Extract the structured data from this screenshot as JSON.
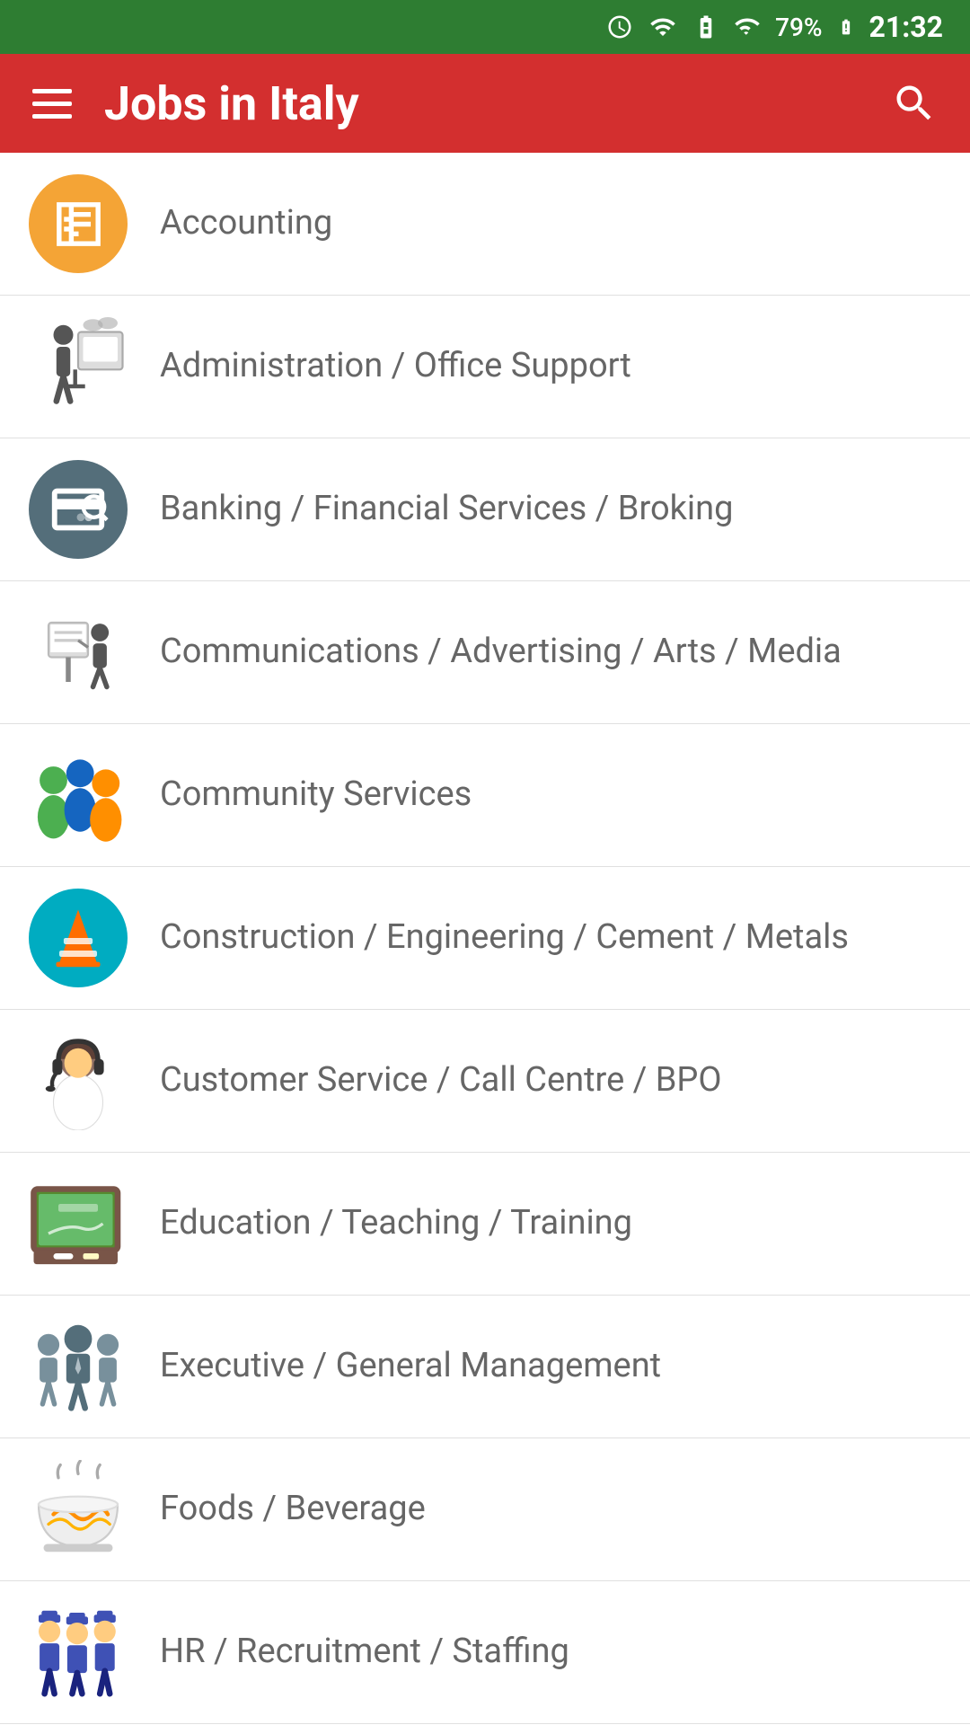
{
  "statusBar": {
    "battery": "79%",
    "time": "21:32",
    "icons": [
      "alarm",
      "wifi",
      "battery-charge",
      "signal",
      "signal2"
    ]
  },
  "toolbar": {
    "title": "Jobs in Italy",
    "menuLabel": "Menu",
    "searchLabel": "Search"
  },
  "categories": [
    {
      "id": "accounting",
      "label": "Accounting",
      "iconType": "circle-orange",
      "emoji": "🧮"
    },
    {
      "id": "admin",
      "label": "Administration / Office Support",
      "iconType": "illustration",
      "emoji": "📋"
    },
    {
      "id": "banking",
      "label": "Banking / Financial Services / Broking",
      "iconType": "circle-teal",
      "emoji": "💳"
    },
    {
      "id": "communications",
      "label": "Communications / Advertising / Arts / Media",
      "iconType": "illustration",
      "emoji": "📣"
    },
    {
      "id": "community",
      "label": "Community Services",
      "iconType": "illustration",
      "emoji": "👥"
    },
    {
      "id": "construction",
      "label": "Construction / Engineering / Cement / Metals",
      "iconType": "circle-cyan",
      "emoji": "🚧"
    },
    {
      "id": "customer-service",
      "label": "Customer Service / Call Centre / BPO",
      "iconType": "illustration",
      "emoji": "🎧"
    },
    {
      "id": "education",
      "label": "Education / Teaching / Training",
      "iconType": "illustration",
      "emoji": "📗"
    },
    {
      "id": "executive",
      "label": "Executive / General Management",
      "iconType": "illustration",
      "emoji": "👔"
    },
    {
      "id": "foods",
      "label": "Foods / Beverage",
      "iconType": "illustration",
      "emoji": "🍜"
    },
    {
      "id": "hr",
      "label": "HR / Recruitment / Staffing",
      "iconType": "illustration",
      "emoji": "👮"
    }
  ]
}
